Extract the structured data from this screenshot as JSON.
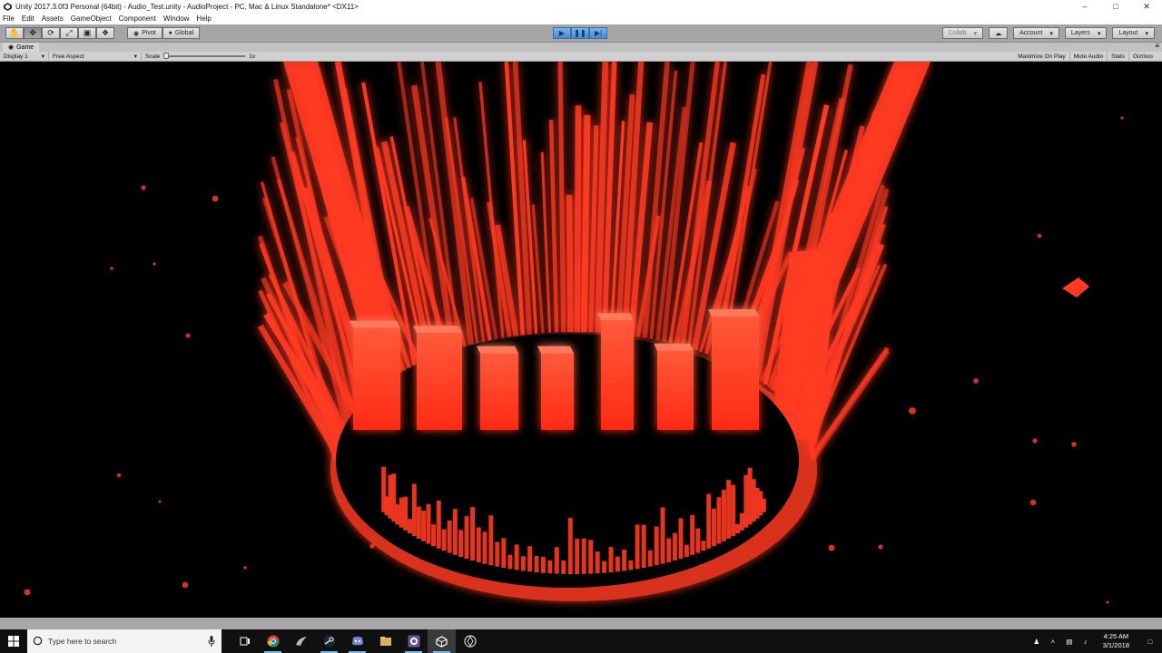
{
  "window": {
    "title": "Unity 2017.3.0f3 Personal (64bit) - Audio_Test.unity - AudioProject - PC, Mac & Linux Standalone* <DX11>",
    "minimize_icon": "minimize-icon",
    "maximize_icon": "maximize-icon",
    "close_icon": "close-icon"
  },
  "menu": {
    "items": [
      "File",
      "Edit",
      "Assets",
      "GameObject",
      "Component",
      "Window",
      "Help"
    ]
  },
  "toolbar": {
    "pivot_label": "Pivot",
    "global_label": "Global",
    "collab_label": "Collab",
    "account_label": "Account",
    "layers_label": "Layers",
    "layout_label": "Layout"
  },
  "game_view": {
    "tab_label": "Game",
    "display_label": "Display 1",
    "aspect_label": "Free Aspect",
    "scale_label": "Scale",
    "scale_value": "1x",
    "maximize_label": "Maximize On Play",
    "mute_label": "Mute Audio",
    "stats_label": "Stats",
    "gizmos_label": "Gizmos"
  },
  "scene": {
    "glow_color": "#ff3a22",
    "bar_count": 7,
    "bar_levels": [
      0.86,
      0.82,
      0.66,
      0.66,
      0.92,
      0.68,
      0.95
    ]
  },
  "taskbar": {
    "search_placeholder": "Type here to search",
    "time": "4:25 AM",
    "date": "3/1/2018",
    "apps": [
      "task-view-icon",
      "chrome-icon",
      "inkscape-icon",
      "steam-icon",
      "discord-icon",
      "file-explorer-icon",
      "github-icon",
      "unity-icon",
      "unity-hub-icon"
    ]
  },
  "colors": {
    "accent_play": "#4a8ad0",
    "taskbar_bg": "#101010",
    "editor_gray": "#c2c2c2"
  }
}
